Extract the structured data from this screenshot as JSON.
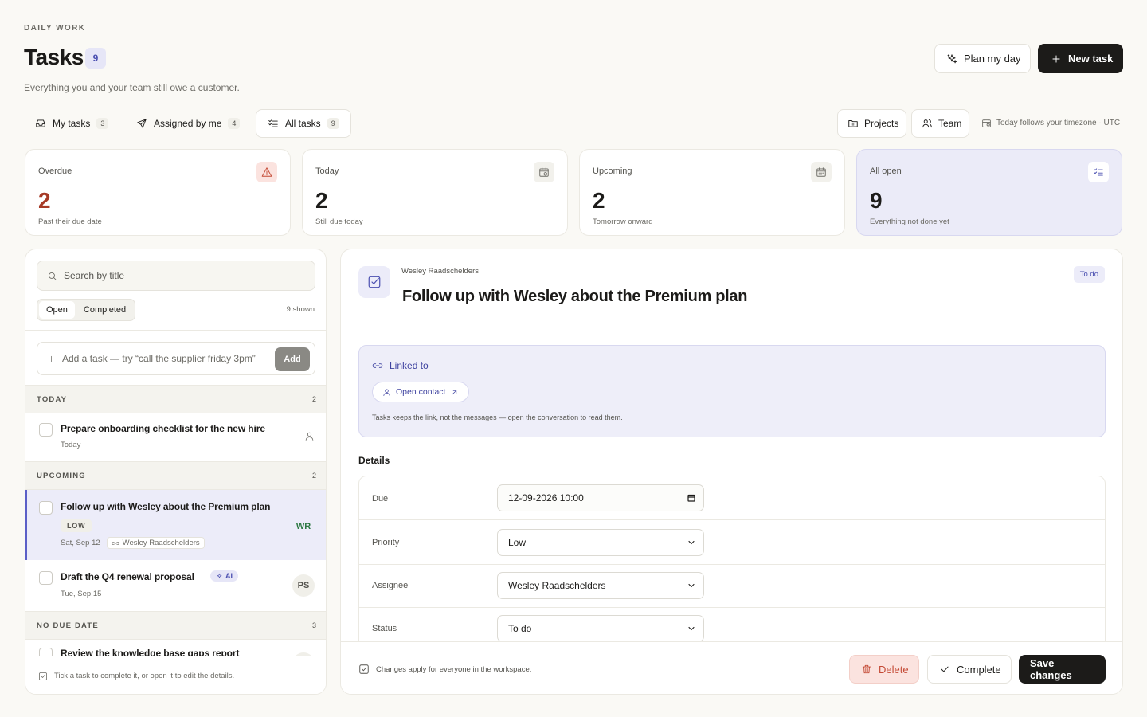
{
  "header": {
    "eyebrow": "DAILY WORK",
    "title": "Tasks",
    "title_count": "9",
    "subtitle": "Everything you and your team still owe a customer.",
    "plan_label": "Plan my day",
    "new_task_label": "New task"
  },
  "scopes": [
    {
      "label": "My tasks",
      "count": "3",
      "icon": "inbox-icon"
    },
    {
      "label": "Assigned by me",
      "count": "4",
      "icon": "send-icon"
    },
    {
      "label": "All tasks",
      "count": "9",
      "icon": "list-check-icon",
      "active": true
    }
  ],
  "toolbar": {
    "projects_label": "Projects",
    "team_label": "Team",
    "timezone_note": "Today follows your timezone · UTC"
  },
  "stats": [
    {
      "label": "Overdue",
      "value": "2",
      "sub": "Past their due date",
      "icon": "alert-triangle-icon"
    },
    {
      "label": "Today",
      "value": "2",
      "sub": "Still due today",
      "icon": "calendar-clock-icon"
    },
    {
      "label": "Upcoming",
      "value": "2",
      "sub": "Tomorrow onward",
      "icon": "calendar-icon"
    },
    {
      "label": "All open",
      "value": "9",
      "sub": "Everything not done yet",
      "icon": "list-check-icon"
    }
  ],
  "list": {
    "search_placeholder": "Search by title",
    "filter_open": "Open",
    "filter_completed": "Completed",
    "shown": "9 shown",
    "quick_add_placeholder": "Add a task — try “call the supplier friday 3pm”",
    "add_label": "Add",
    "groups": {
      "today": {
        "label": "TODAY",
        "count": "2"
      },
      "upcoming": {
        "label": "UPCOMING",
        "count": "2"
      },
      "nodate": {
        "label": "NO DUE DATE",
        "count": "3"
      }
    },
    "tasks": [
      {
        "title": "Prepare onboarding checklist for the new hire",
        "due": "Today"
      },
      {
        "title": "Follow up with Wesley about the Premium plan",
        "priority": "LOW",
        "due": "Sat, Sep 12",
        "contact": "Wesley Raadschelders",
        "avatar": "WR"
      },
      {
        "title": "Draft the Q4 renewal proposal",
        "badge": "AI",
        "due": "Tue, Sep 15",
        "avatar": "PS"
      },
      {
        "title": "Review the knowledge base gaps report",
        "avatar": "WR"
      }
    ],
    "footer_note": "Tick a task to complete it, or open it to edit the details."
  },
  "detail": {
    "contact": "Wesley Raadschelders",
    "title": "Follow up with Wesley about the Premium plan",
    "status_badge": "To do",
    "linked_title": "Linked to",
    "open_contact_label": "Open contact",
    "linked_note": "Tasks keeps the link, not the messages — open the conversation to read them.",
    "details_heading": "Details",
    "fields": {
      "due_label": "Due",
      "due_value": "12-09-2026 10:00",
      "priority_label": "Priority",
      "priority_value": "Low",
      "assignee_label": "Assignee",
      "assignee_value": "Wesley Raadschelders",
      "status_label": "Status",
      "status_value": "To do"
    },
    "footer_note": "Changes apply for everyone in the workspace.",
    "delete_label": "Delete",
    "complete_label": "Complete",
    "save_label": "Save changes"
  },
  "colors": {
    "background": "#faf9f5",
    "accent": "#5b5fc7",
    "accent_soft": "#ececf9",
    "danger": "#c44a35",
    "dark": "#1c1b19"
  }
}
